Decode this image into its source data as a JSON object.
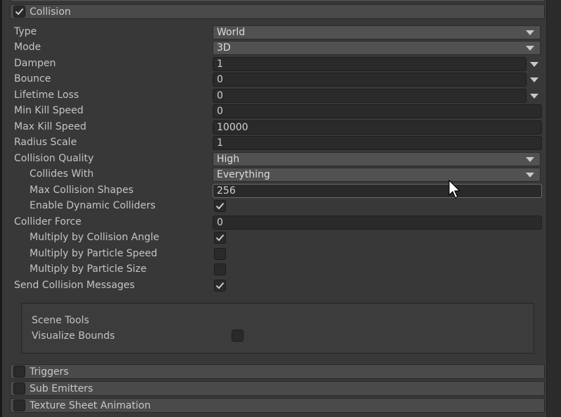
{
  "modules": {
    "collision": {
      "label": "Collision",
      "enabled": true
    },
    "triggers": {
      "label": "Triggers",
      "enabled": false
    },
    "sub_emitters": {
      "label": "Sub Emitters",
      "enabled": false
    },
    "texture_sheet": {
      "label": "Texture Sheet Animation",
      "enabled": false
    }
  },
  "collision": {
    "type": {
      "label": "Type",
      "value": "World"
    },
    "mode": {
      "label": "Mode",
      "value": "3D"
    },
    "dampen": {
      "label": "Dampen",
      "value": "1"
    },
    "bounce": {
      "label": "Bounce",
      "value": "0"
    },
    "lifetime_loss": {
      "label": "Lifetime Loss",
      "value": "0"
    },
    "min_kill_speed": {
      "label": "Min Kill Speed",
      "value": "0"
    },
    "max_kill_speed": {
      "label": "Max Kill Speed",
      "value": "10000"
    },
    "radius_scale": {
      "label": "Radius Scale",
      "value": "1"
    },
    "collision_quality": {
      "label": "Collision Quality",
      "value": "High"
    },
    "collides_with": {
      "label": "Collides With",
      "value": "Everything"
    },
    "max_collision_shapes": {
      "label": "Max Collision Shapes",
      "value": "256"
    },
    "enable_dynamic_colliders": {
      "label": "Enable Dynamic Colliders",
      "checked": true
    },
    "collider_force": {
      "label": "Collider Force",
      "value": "0"
    },
    "multiply_angle": {
      "label": "Multiply by Collision Angle",
      "checked": true
    },
    "multiply_speed": {
      "label": "Multiply by Particle Speed",
      "checked": false
    },
    "multiply_size": {
      "label": "Multiply by Particle Size",
      "checked": false
    },
    "send_messages": {
      "label": "Send Collision Messages",
      "checked": true
    }
  },
  "scene_tools": {
    "title": "Scene Tools",
    "visualize_bounds": {
      "label": "Visualize Bounds",
      "checked": false
    }
  },
  "colors": {
    "panel": "#383838",
    "header": "#4a4a4a",
    "field": "#2a2a2a",
    "dropdown": "#515151",
    "text": "#c4c4c4"
  },
  "icons": {
    "check": "check-icon",
    "caret": "caret-down-icon",
    "cursor": "mouse-cursor-icon"
  }
}
